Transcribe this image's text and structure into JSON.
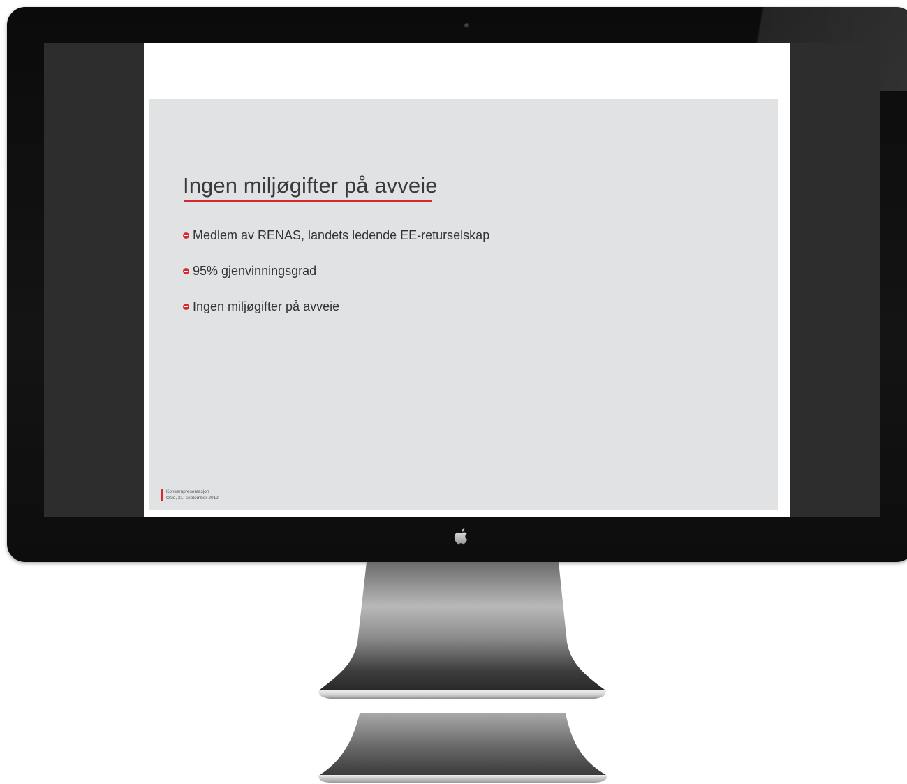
{
  "slide": {
    "title": "Ingen miljøgifter på avveie",
    "bullets": [
      "Medlem av RENAS, landets ledende EE-returselskap",
      "95% gjenvinningsgrad",
      "Ingen miljøgifter på avveie"
    ],
    "footer": {
      "line1": "Konsernpresentasjon",
      "line2": "Oslo, 21. september 2012"
    }
  },
  "colors": {
    "accent": "#d8282f",
    "slide_background": "#e1e2e4",
    "bezel": "#111111",
    "screen_side": "#2d2d2d"
  },
  "icons": {
    "bezel_logo": "apple-logo-icon",
    "bullet": "red-plus-circle-icon",
    "camera": "camera-icon"
  }
}
